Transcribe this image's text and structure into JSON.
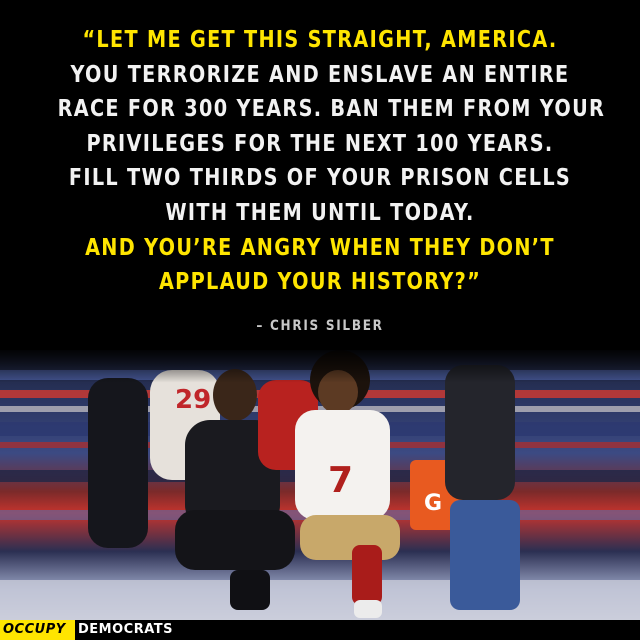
{
  "quote": {
    "lines": [
      {
        "text": "“LET ME GET THIS STRAIGHT, AMERICA.",
        "color": "yellow"
      },
      {
        "text": "YOU TERRORIZE AND ENSLAVE AN ENTIRE",
        "color": "white"
      },
      {
        "text": "RACE FOR 300 YEARS. BAN THEM FROM YOUR",
        "color": "white"
      },
      {
        "text": "PRIVILEGES FOR THE NEXT 100 YEARS.",
        "color": "white"
      },
      {
        "text": "FILL TWO THIRDS OF YOUR PRISON CELLS",
        "color": "white"
      },
      {
        "text": "WITH THEM UNTIL TODAY.",
        "color": "white"
      },
      {
        "text": "AND YOU’RE ANGRY WHEN THEY DON’T",
        "color": "yellow"
      },
      {
        "text": "APPLAUD YOUR HISTORY?”",
        "color": "yellow"
      }
    ],
    "attribution": "– CHRIS SILBER"
  },
  "photo": {
    "jersey_number": "7",
    "jersey_number_2": "29"
  },
  "logo": {
    "occupy": "OCCUPY",
    "democrats": "DEMOCRATS"
  },
  "colors": {
    "accent": "#ffe500",
    "background": "#000000",
    "text": "#f2f2f2"
  }
}
